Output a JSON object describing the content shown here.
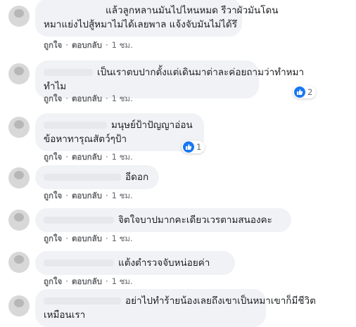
{
  "colors": {
    "bubble_bg": "#f0f2f5",
    "meta_text": "#65676b",
    "like_blue": "#1877f2"
  },
  "actions": {
    "like": "ถูกใจ",
    "reply": "ตอบกลับ",
    "separator": "·"
  },
  "comments": [
    {
      "lines": [
        "แล้วลูกหลานมันไปไหนหมด รีวาผัวมันโดน",
        "หมาแย่งไปสู้หมาไม่ได้เลยพาล แจ้งจับมันไม่ได้รึ"
      ],
      "time": "1 ชม."
    },
    {
      "lines": [
        "เป็นเราตบปากตั้งแต่เดินมาต่าละค่อยถามว่าทำหมา",
        "ทำไม"
      ],
      "time": "1 ชม.",
      "reactions": "2"
    },
    {
      "lines": [
        "มนุษย์ป้าปัญญาอ่อน",
        "ข้อหาทารุณสัตว์ๆป้า"
      ],
      "time": "1 ชม.",
      "reactions": "1"
    },
    {
      "lines": [
        "อีดอก"
      ],
      "time": "1 ชม."
    },
    {
      "lines": [
        "จิตใจบาปมากคะเดียวเวรตามสนองคะ"
      ],
      "time": "1 ชม."
    },
    {
      "lines": [
        "แต้งตำรวจจับหน่อยค่า"
      ],
      "time": "1 ชม."
    },
    {
      "lines": [
        "อย่าไปทำร้ายน้องเลยถึงเขาเป็นหมาเขาก็มีชีวิต",
        "เหมือนเรา"
      ]
    }
  ]
}
